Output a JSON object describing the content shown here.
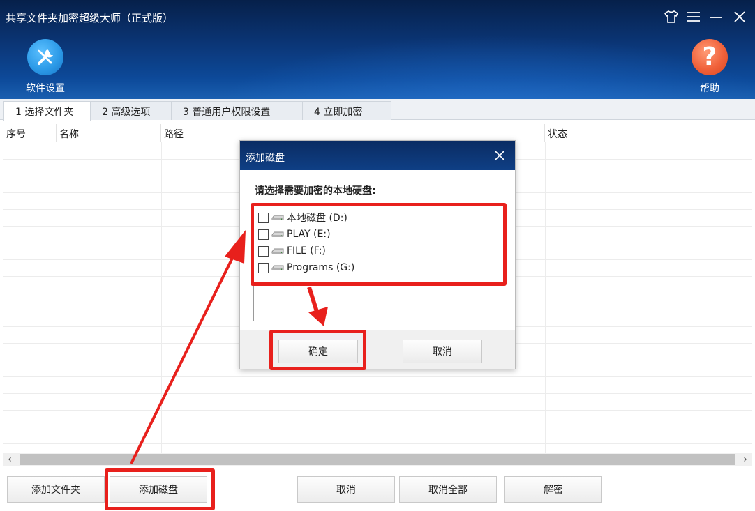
{
  "window": {
    "title": "共享文件夹加密超级大师（正式版）",
    "controls": [
      "shirt-icon",
      "menu-icon",
      "minimize-icon",
      "close-icon"
    ]
  },
  "toolbar": {
    "settings_label": "软件设置",
    "help_label": "帮助"
  },
  "tabs": [
    {
      "label": "1 选择文件夹",
      "active": true
    },
    {
      "label": "2 高级选项",
      "active": false
    },
    {
      "label": "3 普通用户权限设置",
      "active": false
    },
    {
      "label": "4 立即加密",
      "active": false
    }
  ],
  "table": {
    "columns": [
      "序号",
      "名称",
      "路径",
      "状态"
    ],
    "rows": []
  },
  "bottom_buttons": {
    "add_folder": "添加文件夹",
    "add_disk": "添加磁盘",
    "cancel": "取消",
    "cancel_all": "取消全部",
    "decrypt": "解密"
  },
  "dialog": {
    "title": "添加磁盘",
    "prompt": "请选择需要加密的本地硬盘:",
    "disks": [
      {
        "label": "本地磁盘 (D:)",
        "checked": false
      },
      {
        "label": "PLAY (E:)",
        "checked": false
      },
      {
        "label": "FILE (F:)",
        "checked": false
      },
      {
        "label": "Programs (G:)",
        "checked": false
      }
    ],
    "ok_label": "确定",
    "cancel_label": "取消"
  },
  "colors": {
    "header_top": "#06204a",
    "header_bottom": "#1a5fb0",
    "settings_icon_bg": "#2d9be8",
    "help_icon_bg": "#f0613a",
    "annotation_red": "#e8201c"
  }
}
